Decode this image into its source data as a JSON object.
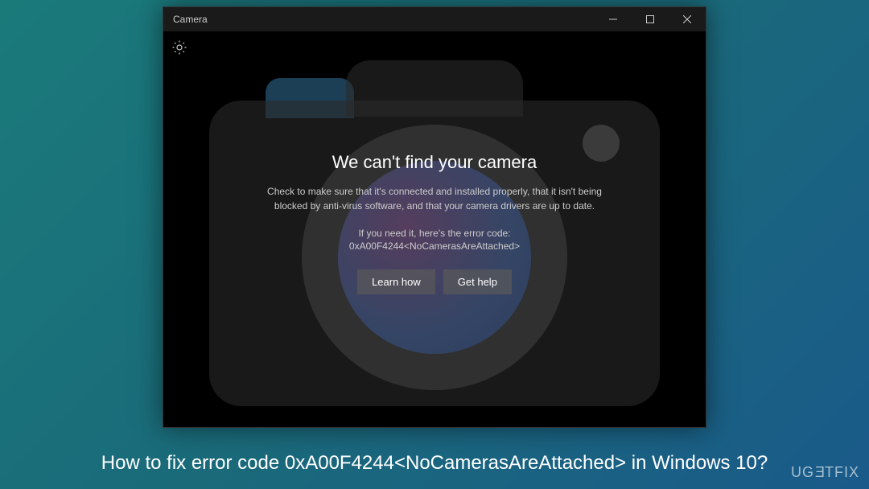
{
  "window": {
    "title": "Camera"
  },
  "error": {
    "title": "We can't find your camera",
    "description": "Check to make sure that it's connected and installed properly, that it isn't being blocked by anti-virus software, and that your camera drivers are up to date.",
    "code_label": "If you need it, here's the error code:",
    "code": "0xA00F4244<NoCamerasAreAttached>",
    "buttons": {
      "learn": "Learn how",
      "help": "Get help"
    }
  },
  "caption": "How to fix error code 0xA00F4244<NoCamerasAreAttached> in Windows 10?",
  "watermark": "UGETFIX"
}
